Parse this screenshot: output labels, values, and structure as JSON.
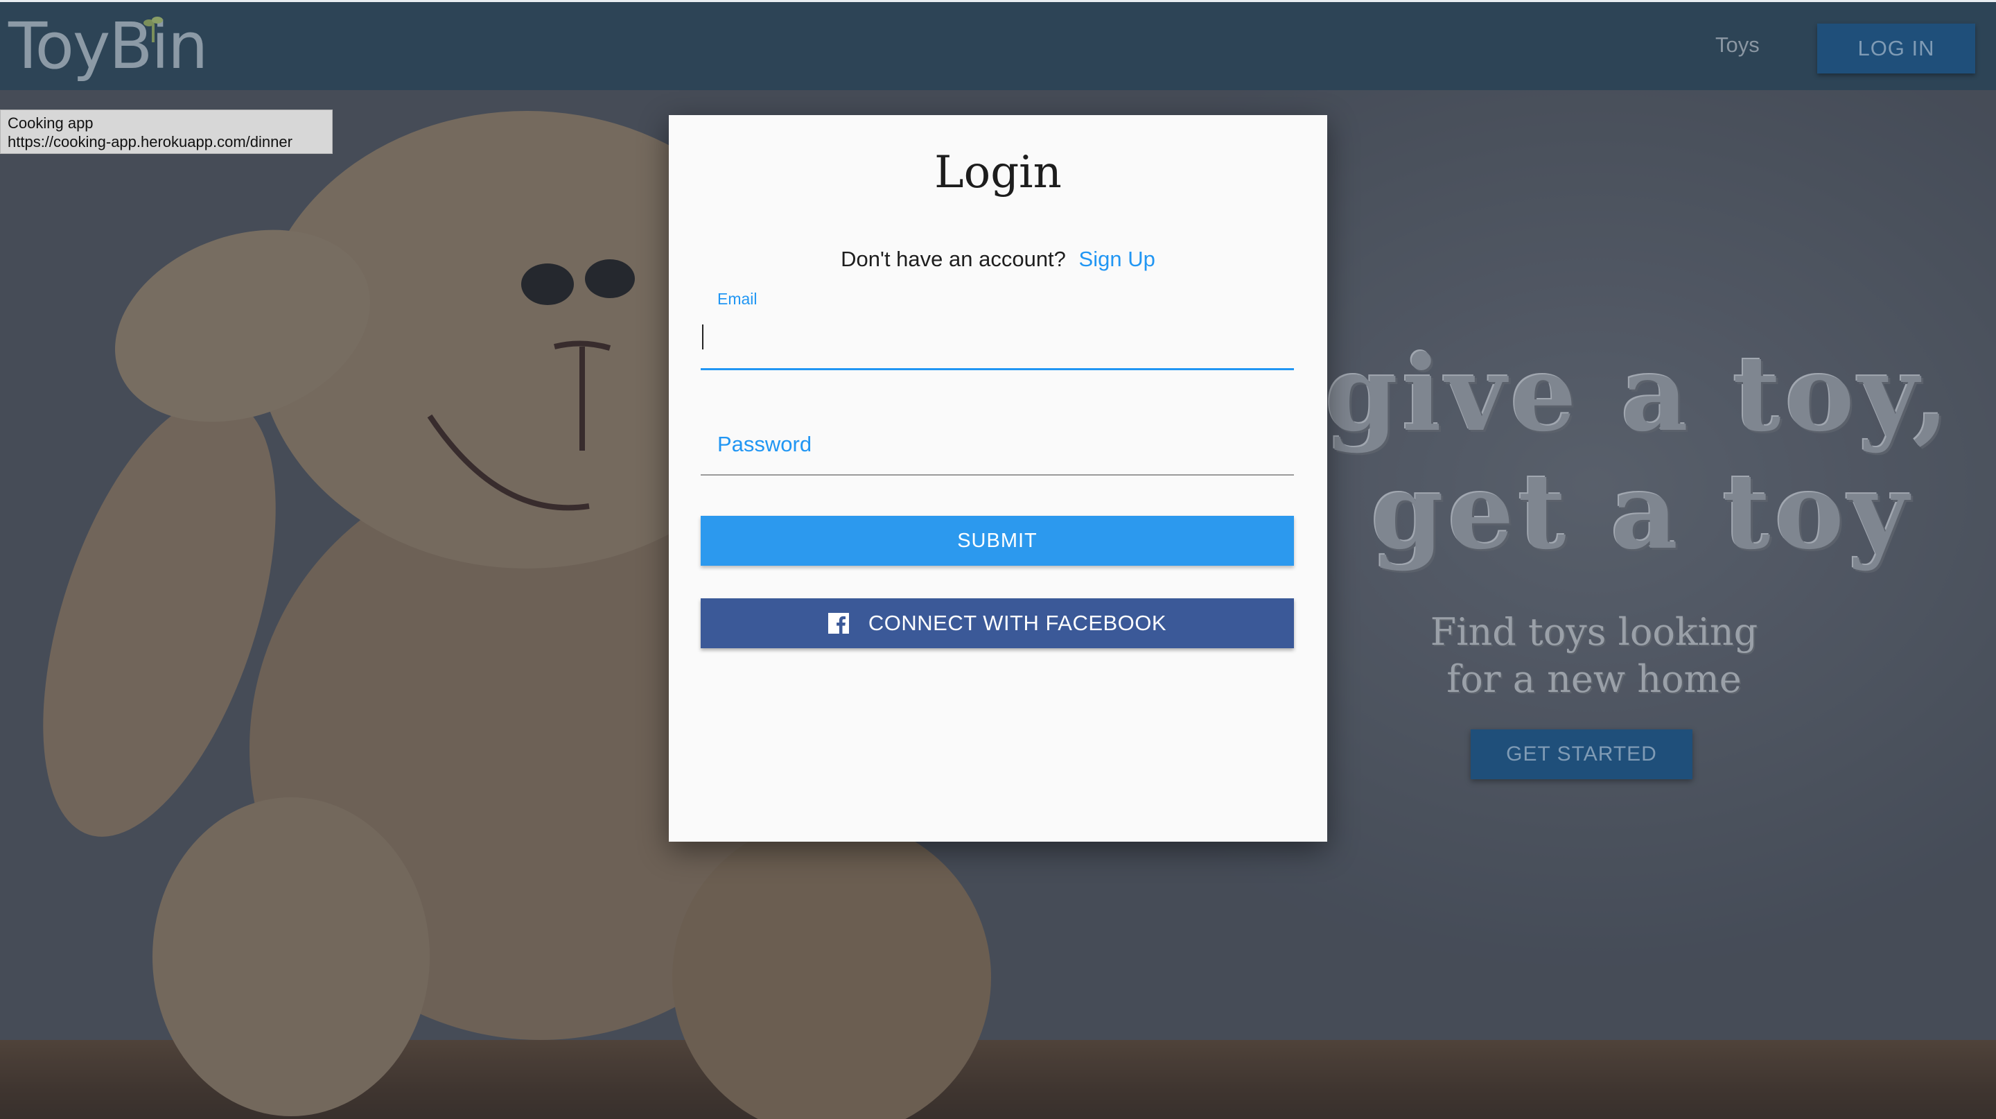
{
  "navbar": {
    "logo_text": "ToyBin",
    "toys_link": "Toys",
    "login_button": "LOG IN"
  },
  "tooltip": {
    "title": "Cooking app",
    "url": "https://cooking-app.herokuapp.com/dinner"
  },
  "hero": {
    "line1": "give a toy,",
    "line2": "get a toy",
    "sub_line1": "Find toys looking",
    "sub_line2": "for a new home",
    "cta": "GET STARTED"
  },
  "login_modal": {
    "title": "Login",
    "signup_prompt": "Don't have an account?",
    "signup_link": "Sign Up",
    "email_label": "Email",
    "email_value": "",
    "password_placeholder": "Password",
    "submit_label": "SUBMIT",
    "facebook_label": "CONNECT WITH FACEBOOK"
  },
  "colors": {
    "navbar_bg": "#2d4456",
    "primary_blue": "#2196f3",
    "facebook_blue": "#3b5998",
    "dark_button": "#1f4f7a"
  },
  "icons": {
    "facebook": "facebook-icon",
    "logo_sprout": "sprout-icon"
  }
}
